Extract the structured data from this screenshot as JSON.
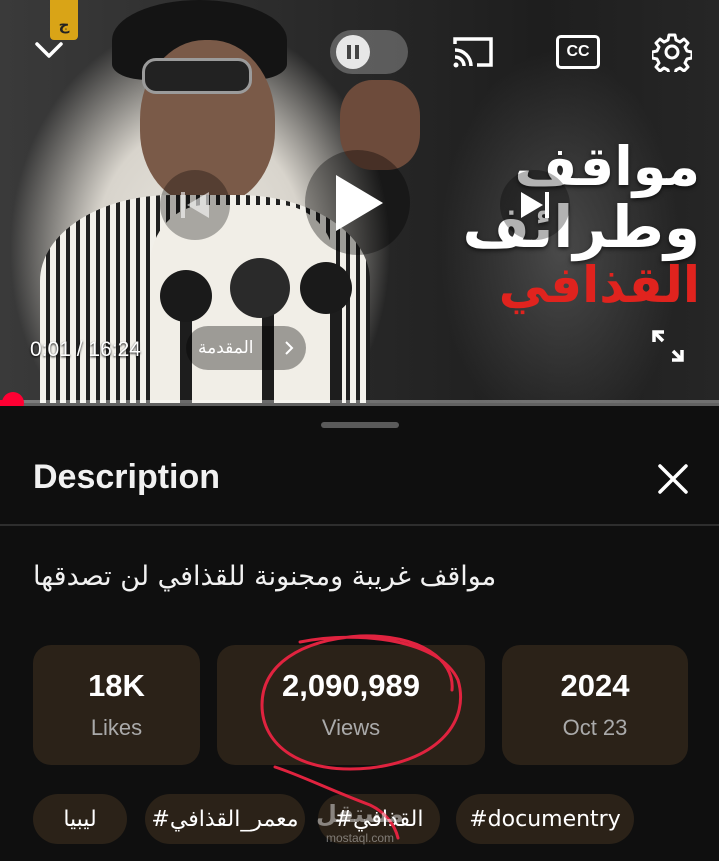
{
  "player": {
    "time_current": "0:01",
    "time_separator": " / ",
    "time_total": "16:24",
    "chapter_label": "المقدمة",
    "progress_fraction": 0.001,
    "logo_text": "ج",
    "overlay_line1": "مواقف",
    "overlay_line2": "وطرائف",
    "overlay_line3": "القذافي",
    "icons": {
      "collapse": "chevron-down-icon",
      "pause": "pause-icon",
      "cast": "cast-icon",
      "captions": "cc-icon",
      "settings": "gear-icon",
      "previous": "skip-previous-icon",
      "play": "play-icon",
      "next": "skip-next-icon",
      "fullscreen": "fullscreen-icon",
      "chapter_chevron": "chevron-right-icon"
    },
    "captions_label": "CC"
  },
  "description": {
    "header": "Description",
    "close_icon": "close-icon",
    "video_title": "مواقف غريبة ومجنونة للقذافي لن تصدقها",
    "stats": [
      {
        "value": "18K",
        "label": "Likes"
      },
      {
        "value": "2,090,989",
        "label": "Views"
      },
      {
        "value": "2024",
        "label": "Oct 23"
      }
    ],
    "tags": [
      "ليبيا",
      "#معمر_القذافي",
      "#القذافي",
      "#documentry"
    ]
  },
  "watermark": {
    "brand": "مستقل",
    "site": "mostaql.com"
  },
  "colors": {
    "background": "#0f0f0f",
    "chip": "#2b2218",
    "accent_red": "#ff0033",
    "annotation_red": "#e0233f",
    "overlay_red": "#e0231e"
  }
}
